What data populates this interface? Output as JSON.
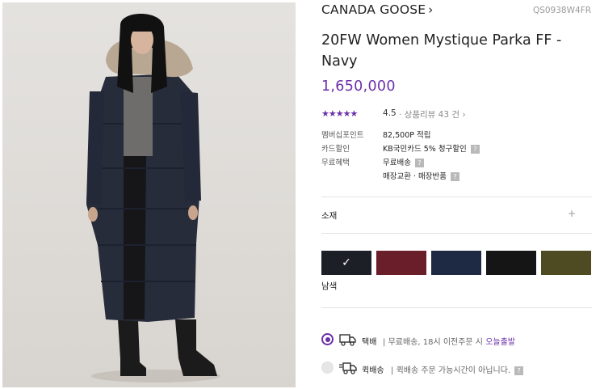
{
  "product": {
    "brand": "CANADA GOOSE",
    "code": "QS0938W4FR",
    "title": "20FW Women Mystique Parka FF - Navy",
    "price": "1,650,000"
  },
  "rating": {
    "value": 4.5,
    "stars_display": "★★★★★",
    "score_text": "4.5",
    "reviews_text": "· 상품리뷰 43 건 ›"
  },
  "benefits": [
    {
      "label": "멤버십포인트",
      "value": "82,500P 적립"
    },
    {
      "label": "카드할인",
      "value": "KB국민카드 5% 청구할인"
    },
    {
      "label": "무료혜택",
      "value": "무료배송"
    },
    {
      "label": "",
      "value": "매장교환 · 매장반품"
    }
  ],
  "accordion": {
    "label": "소재",
    "icon": "plus-icon",
    "symbol": "+"
  },
  "colors": {
    "selected_name": "남색",
    "swatches": [
      {
        "name": "navy",
        "hex": "#1c1f26",
        "selected": true,
        "check": "✓"
      },
      {
        "name": "red",
        "hex": "#6a1e2a",
        "selected": false
      },
      {
        "name": "blue",
        "hex": "#1e2a44",
        "selected": false
      },
      {
        "name": "black",
        "hex": "#151515",
        "selected": false
      },
      {
        "name": "olive",
        "hex": "#4e4b22",
        "selected": false
      }
    ]
  },
  "shipping": [
    {
      "name": "택배",
      "desc_pre": "무료배송, 18시 이전주문 시 ",
      "desc_hl": "오늘출발",
      "selected": true
    },
    {
      "name": "퀵배송",
      "desc_pre": "퀵배송 주문 가능시간이 아닙니다.",
      "desc_hl": "",
      "selected": false
    }
  ],
  "colors_theme": {
    "accent": "#6b2fa8",
    "divider": "#e3e3e3"
  }
}
